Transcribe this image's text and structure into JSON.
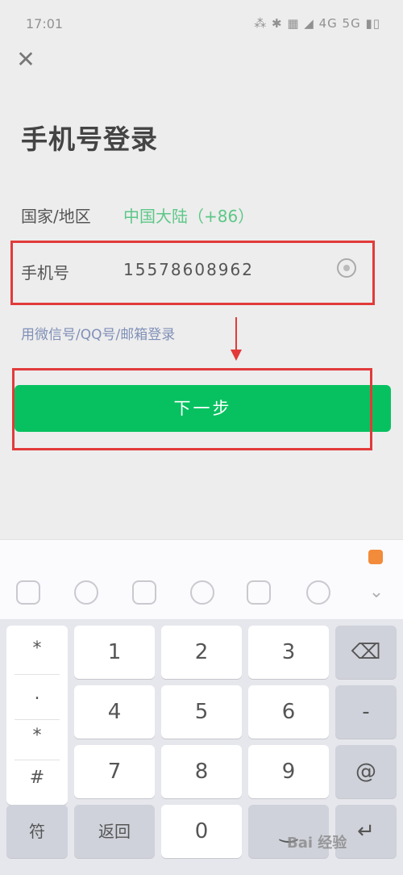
{
  "status_bar": {
    "time": "17:01",
    "icons": "⁂ ✱ ▦ ◢ 4G 5G ▮▯"
  },
  "login": {
    "close_label": "✕",
    "title": "手机号登录",
    "region_label": "国家/地区",
    "region_value": "中国大陆（+86）",
    "phone_label": "手机号",
    "phone_value": "15578608962",
    "alt_login": "用微信号/QQ号/邮箱登录",
    "next_button": "下一步"
  },
  "annotation": {
    "highlight_color": "#e23a3a",
    "accent": "#07c160"
  },
  "keyboard": {
    "toolbar": [
      "app-icon",
      "emoji-icon",
      "clipboard-icon",
      "mic-icon",
      "handwrite-icon",
      "search-icon",
      "collapse-icon"
    ],
    "symbols": [
      "*",
      ".",
      "*",
      "#"
    ],
    "keys": {
      "k1": "1",
      "k2": "2",
      "k3": "3",
      "k4": "4",
      "k5": "5",
      "k6": "6",
      "k7": "7",
      "k8": "8",
      "k9": "9",
      "k0": "0",
      "backspace": "⌫",
      "dash": "-",
      "at": "@",
      "enter": "↵",
      "symbol_key": "符",
      "return_key": "返回",
      "space": "‿"
    }
  },
  "watermark": {
    "text": "Bai 经验"
  }
}
